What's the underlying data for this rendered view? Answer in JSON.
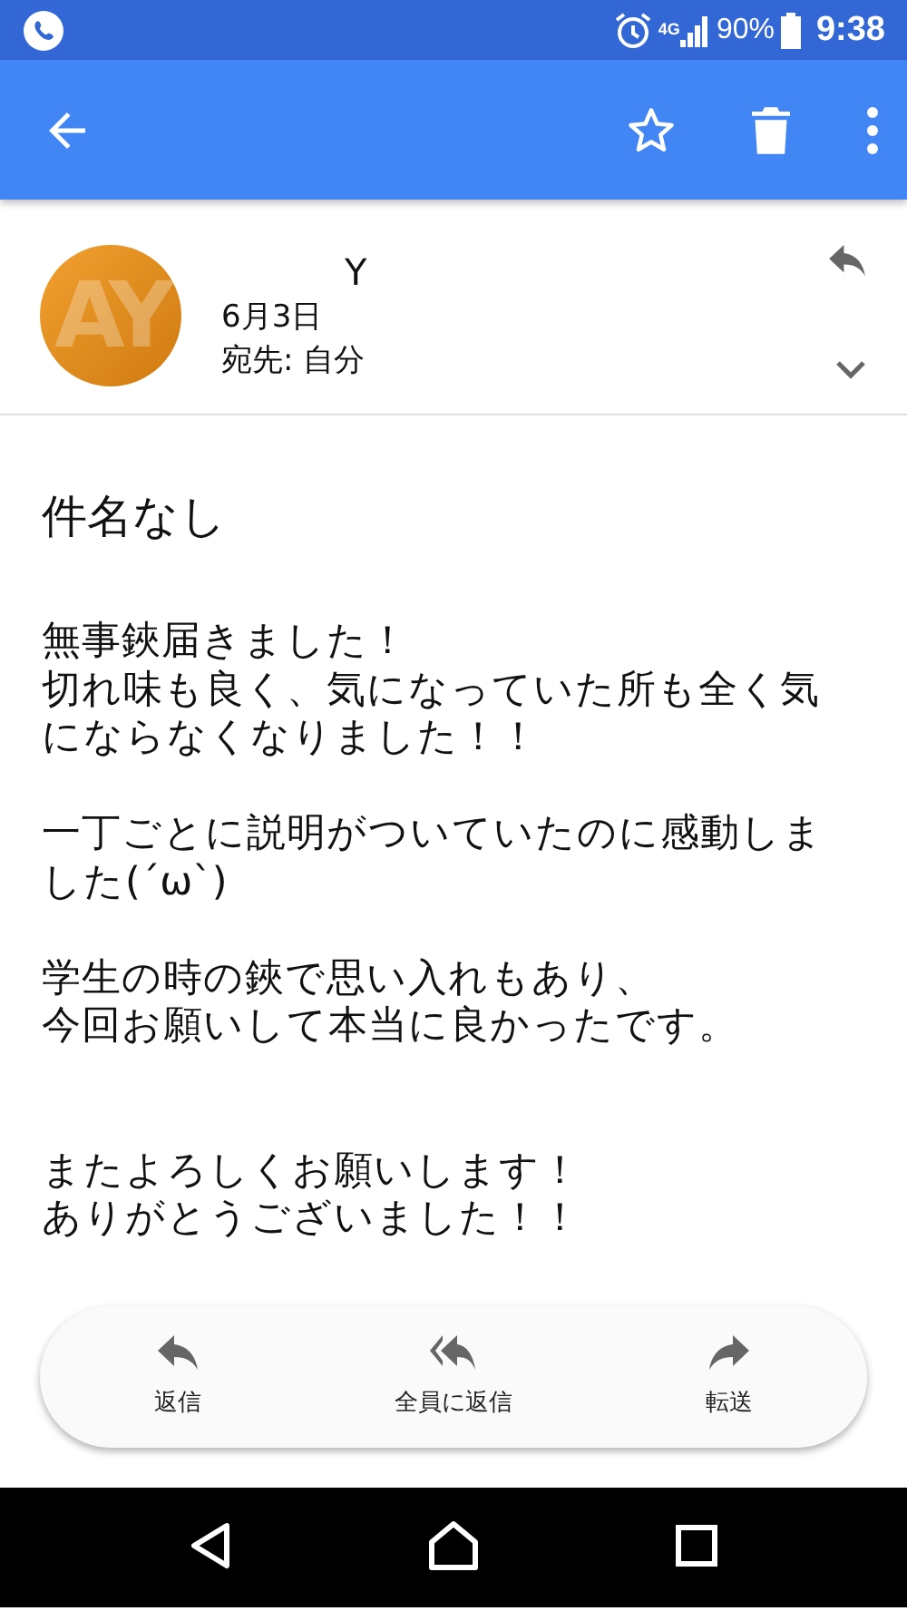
{
  "status_bar": {
    "network": "4G",
    "battery": "90%",
    "time": "9:38"
  },
  "message": {
    "avatar_initials": "AY",
    "sender": "Y",
    "date": "6月3日",
    "recipient": "宛先: 自分",
    "subject": "件名なし",
    "body": [
      [
        "無事鋏届きました！",
        "切れ味も良く、気になっていた所も全く気にならなくなりました！！"
      ],
      [
        "一丁ごとに説明がついていたのに感動しました(´ω`)"
      ],
      [
        "学生の時の鋏で思い入れもあり、",
        "今回お願いして本当に良かったです。"
      ],
      [
        "またよろしくお願いします！",
        "ありがとうございました！！"
      ]
    ]
  },
  "actions": [
    {
      "kind": "reply",
      "label": "返信"
    },
    {
      "kind": "reply_all",
      "label": "全員に返信"
    },
    {
      "kind": "forward",
      "label": "転送"
    }
  ]
}
